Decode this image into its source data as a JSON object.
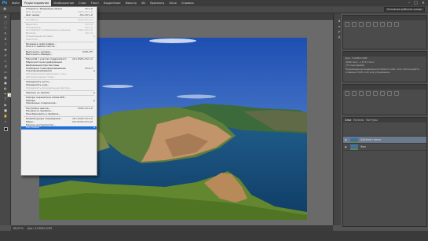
{
  "app": {
    "logo": "Ps"
  },
  "menubar": {
    "items": [
      "Файл",
      "Редактирование",
      "Изображение",
      "Слои",
      "Текст",
      "Выделение",
      "Фильтр",
      "3D",
      "Просмотр",
      "Окно",
      "Справка"
    ],
    "active_index": 1
  },
  "window_controls": [
    "–",
    "□",
    "×"
  ],
  "options_bar": {
    "workspace": "Основная рабочая среда"
  },
  "tooltip": "Ctrl+K",
  "edit_menu": {
    "items": [
      {
        "label": "Отменить: Изменение имени",
        "shortcut": "Ctrl+Z",
        "disabled": false
      },
      {
        "label": "Шаг вперед",
        "shortcut": "Shift+Ctrl+Z",
        "disabled": true
      },
      {
        "label": "Шаг назад",
        "shortcut": "Alt+Ctrl+Z",
        "disabled": false
      },
      {
        "sep": true
      },
      {
        "label": "Ослабить...",
        "shortcut": "Shift+Ctrl+F",
        "disabled": true
      },
      {
        "sep": true
      },
      {
        "label": "Вырезать",
        "shortcut": "Ctrl+X",
        "disabled": true
      },
      {
        "label": "Копировать",
        "shortcut": "Ctrl+C",
        "disabled": true
      },
      {
        "label": "Скопировать совмещенные данные",
        "shortcut": "Shift+Ctrl+C",
        "disabled": true
      },
      {
        "label": "Вклеить",
        "shortcut": "Ctrl+V",
        "disabled": true
      },
      {
        "label": "Специальная вставка",
        "shortcut": "",
        "disabled": true,
        "submenu": true
      },
      {
        "label": "Очистить",
        "shortcut": "",
        "disabled": true
      },
      {
        "sep": true
      },
      {
        "label": "Проверка орфографии...",
        "shortcut": "",
        "disabled": false
      },
      {
        "label": "Поиск и замена текста...",
        "shortcut": "",
        "disabled": false
      },
      {
        "sep": true
      },
      {
        "label": "Выполнить заливку...",
        "shortcut": "Shift+F5",
        "disabled": false
      },
      {
        "label": "Выполнить обводку...",
        "shortcut": "",
        "disabled": false
      },
      {
        "sep": true
      },
      {
        "label": "Масштаб с учетом содержимого",
        "shortcut": "Alt+Shift+Ctrl+C",
        "disabled": false
      },
      {
        "label": "Марионеточная деформация",
        "shortcut": "",
        "disabled": false
      },
      {
        "label": "Деформация перспективы",
        "shortcut": "",
        "disabled": false
      },
      {
        "label": "Свободное трансформирование",
        "shortcut": "Ctrl+T",
        "disabled": false
      },
      {
        "label": "Трансформирование",
        "shortcut": "",
        "disabled": false,
        "submenu": true
      },
      {
        "label": "Автоматически выровнять слои...",
        "shortcut": "",
        "disabled": true
      },
      {
        "label": "Автоналожение слоев...",
        "shortcut": "",
        "disabled": true
      },
      {
        "sep": true
      },
      {
        "label": "Определить кисть...",
        "shortcut": "",
        "disabled": false
      },
      {
        "label": "Определить узор...",
        "shortcut": "",
        "disabled": false
      },
      {
        "label": "Определить произвольную фигуру...",
        "shortcut": "",
        "disabled": true
      },
      {
        "sep": true
      },
      {
        "label": "Удалить из памяти",
        "shortcut": "",
        "disabled": false,
        "submenu": true
      },
      {
        "sep": true
      },
      {
        "label": "Наборы параметров Adobe PDF...",
        "shortcut": "",
        "disabled": false
      },
      {
        "label": "Наборы",
        "shortcut": "",
        "disabled": false,
        "submenu": true
      },
      {
        "label": "Удаленные соединения...",
        "shortcut": "",
        "disabled": false
      },
      {
        "sep": true
      },
      {
        "label": "Настройка цветов...",
        "shortcut": "Shift+Ctrl+K",
        "disabled": false
      },
      {
        "label": "Назначить профиль...",
        "shortcut": "",
        "disabled": false
      },
      {
        "label": "Преобразовать в профиль...",
        "shortcut": "",
        "disabled": false
      },
      {
        "sep": true
      },
      {
        "label": "Клавиатурные сокращения...",
        "shortcut": "Alt+Shift+Ctrl+K",
        "disabled": false
      },
      {
        "label": "Меню...",
        "shortcut": "Alt+Shift+Ctrl+M",
        "disabled": false
      },
      {
        "label": "Панель инструментов...",
        "shortcut": "",
        "disabled": false
      },
      {
        "label": "Настройки",
        "shortcut": "",
        "disabled": false,
        "submenu": true,
        "highlighted": true
      }
    ]
  },
  "statusbar": {
    "zoom": "66,67%",
    "doc": "Док: 5,93M/5,93M"
  },
  "info_panel": {
    "lines": [
      "Док: 5,93M/5,93M",
      "4096 пикс. x 2731 пикс.",
      "(72 пикс/дюйм)"
    ],
    "note": "Перемещение выделенной области или слоя. Используйте клавиши Shift и Alt для управления."
  },
  "layers_panel": {
    "tabs": [
      "Слои",
      "Каналы",
      "Контуры"
    ],
    "layers": [
      {
        "name": "Дубликат фона",
        "selected": true
      },
      {
        "name": "Фон",
        "selected": false
      }
    ]
  }
}
